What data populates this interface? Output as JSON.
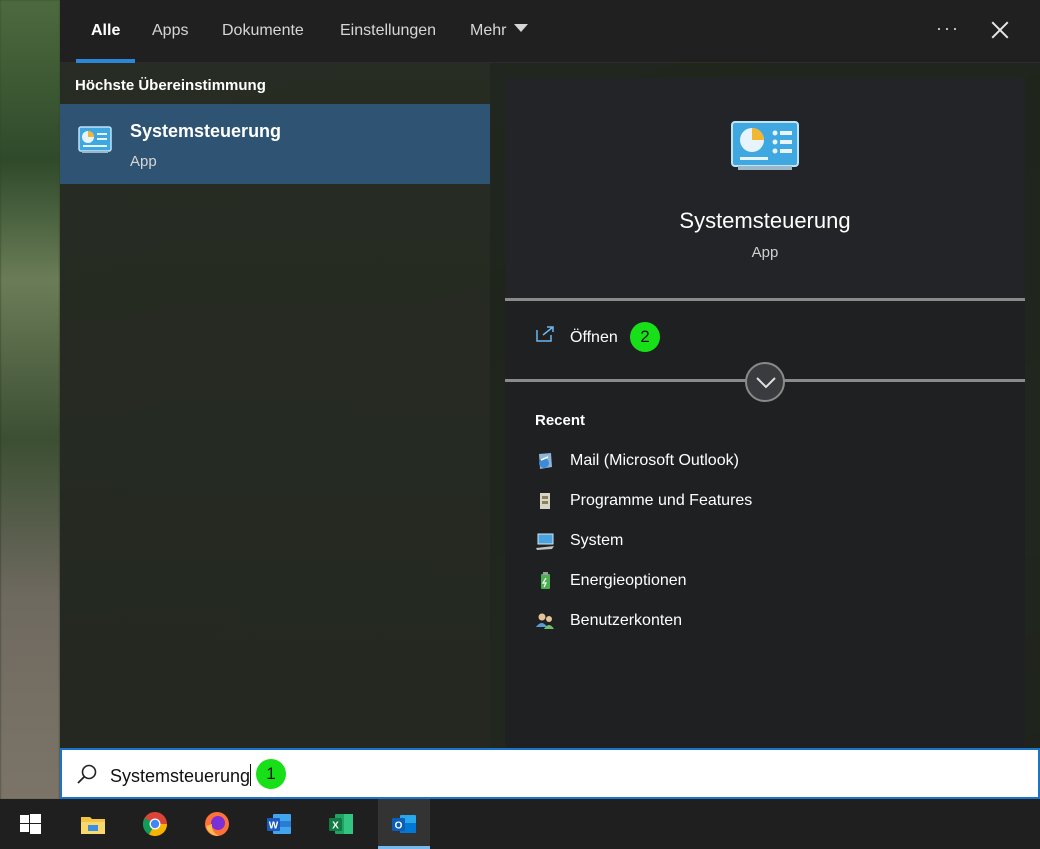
{
  "tabs": [
    {
      "label": "Alle",
      "active": true
    },
    {
      "label": "Apps",
      "active": false
    },
    {
      "label": "Dokumente",
      "active": false
    },
    {
      "label": "Einstellungen",
      "active": false
    },
    {
      "label": "Mehr",
      "active": false
    }
  ],
  "header": {
    "more_options": "···"
  },
  "results": {
    "section_title": "Höchste Übereinstimmung",
    "best_match": {
      "title": "Systemsteuerung",
      "subtitle": "App",
      "icon": "control-panel-icon"
    }
  },
  "preview": {
    "title": "Systemsteuerung",
    "subtitle": "App",
    "open_label": "Öffnen",
    "recent_title": "Recent",
    "recent": [
      {
        "label": "Mail (Microsoft Outlook)",
        "icon": "mail-icon"
      },
      {
        "label": "Programme und Features",
        "icon": "programs-icon"
      },
      {
        "label": "System",
        "icon": "system-icon"
      },
      {
        "label": "Energieoptionen",
        "icon": "power-options-icon"
      },
      {
        "label": "Benutzerkonten",
        "icon": "user-accounts-icon"
      }
    ]
  },
  "search": {
    "value": "Systemsteuerung"
  },
  "badges": {
    "search": "1",
    "open": "2"
  },
  "taskbar": [
    {
      "name": "start-icon"
    },
    {
      "name": "file-explorer-icon"
    },
    {
      "name": "chrome-icon"
    },
    {
      "name": "firefox-icon"
    },
    {
      "name": "word-icon"
    },
    {
      "name": "excel-icon"
    },
    {
      "name": "outlook-icon",
      "active": true
    }
  ],
  "colors": {
    "accent": "#2b88d8",
    "badge": "#18e018",
    "selected": "#2f5473"
  }
}
